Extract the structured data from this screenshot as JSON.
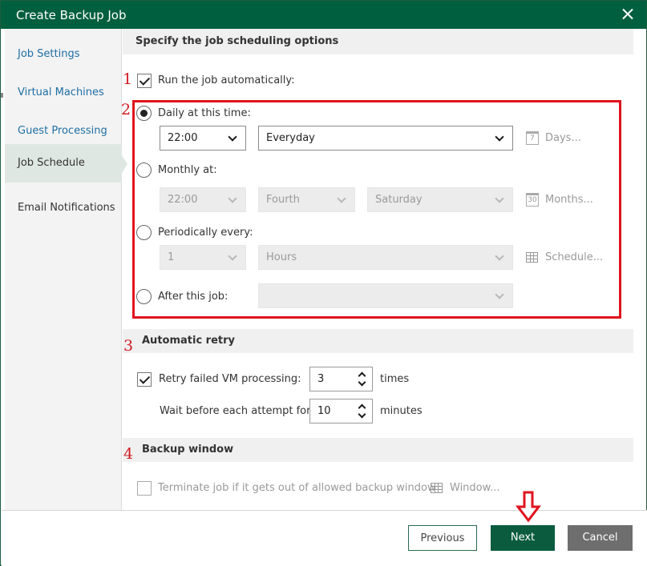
{
  "window": {
    "title": "Create Backup Job"
  },
  "sidebar": {
    "items": [
      {
        "label": "Job Settings"
      },
      {
        "label": "Virtual Machines"
      },
      {
        "label": "Guest Processing"
      },
      {
        "label": "Job Schedule",
        "active": true
      },
      {
        "label": "Email Notifications"
      }
    ]
  },
  "main": {
    "heading": "Specify the job scheduling options",
    "run_automatically": {
      "label": "Run the job automatically:",
      "checked": true
    },
    "daily": {
      "label": "Daily at this time:",
      "time": "22:00",
      "frequency": "Everyday",
      "days_button": "Days...",
      "days_icon_text": "7"
    },
    "monthly": {
      "label": "Monthly at:",
      "time": "22:00",
      "week": "Fourth",
      "day": "Saturday",
      "months_button": "Months...",
      "months_icon_text": "30"
    },
    "periodically": {
      "label": "Periodically every:",
      "count": "1",
      "unit": "Hours",
      "schedule_button": "Schedule..."
    },
    "after_job": {
      "label": "After this job:",
      "value": ""
    },
    "retry": {
      "heading": "Automatic retry",
      "retry_label": "Retry failed VM processing:",
      "retry_value": "3",
      "retry_unit": "times",
      "wait_label": "Wait before each attempt for:",
      "wait_value": "10",
      "wait_unit": "minutes"
    },
    "window_section": {
      "heading": "Backup window",
      "terminate_label": "Terminate job if it gets out of allowed backup window",
      "window_button": "Window..."
    },
    "annotations": [
      "1",
      "2",
      "3",
      "4"
    ]
  },
  "footer": {
    "previous": "Previous",
    "next": "Next",
    "cancel": "Cancel"
  },
  "colors": {
    "brand": "#005f3f",
    "annotation": "#e0141e",
    "link": "#1e6fa5"
  },
  "icons": [
    "close-icon",
    "calendar-icon",
    "grid-icon",
    "chevron-down-icon",
    "down-arrow-icon"
  ]
}
